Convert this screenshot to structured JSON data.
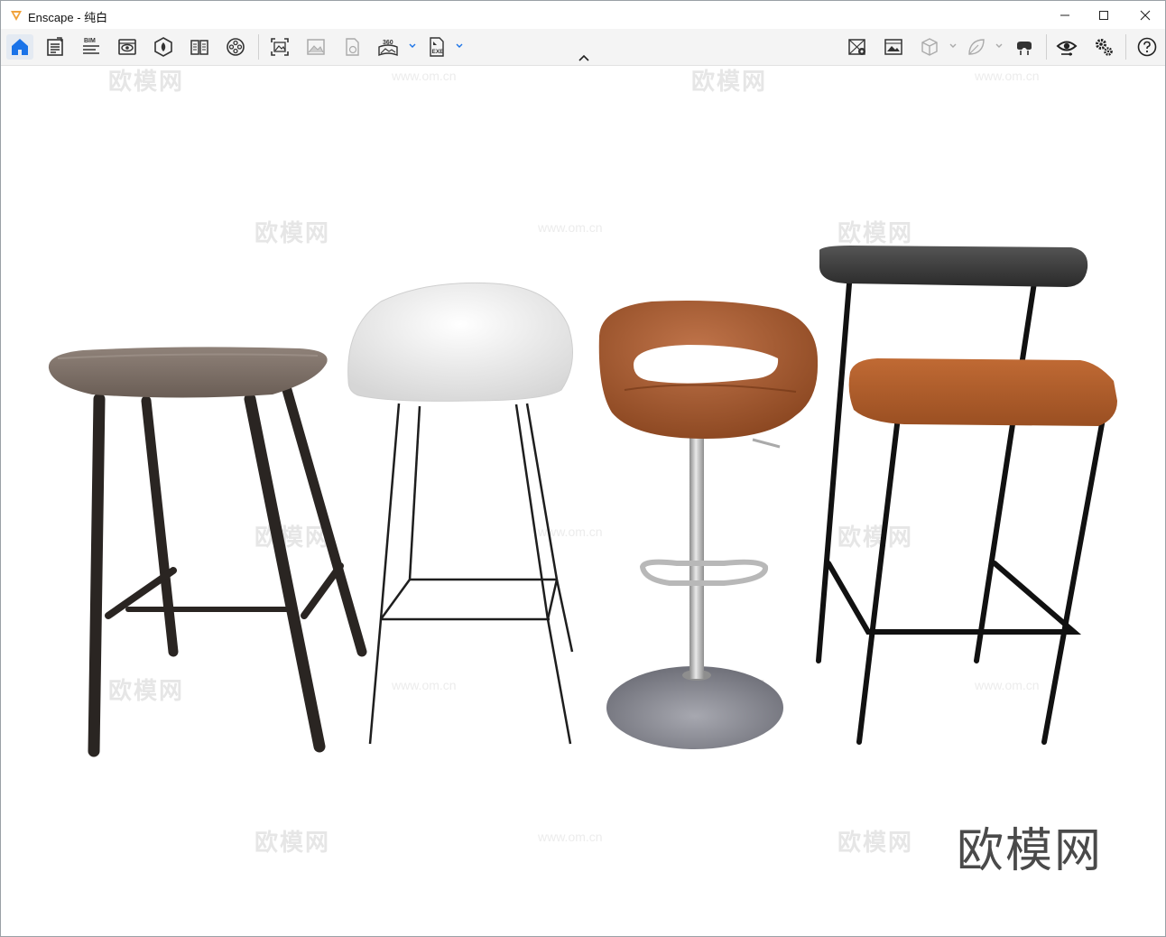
{
  "window": {
    "app_name": "Enscape",
    "separator": " - ",
    "scene_name": "纯白",
    "accent": "#f0a23a"
  },
  "toolbar": {
    "left_icons": [
      "home-icon",
      "file-icon",
      "bim-icon",
      "visual-settings-icon",
      "asset-library-icon",
      "book-icon",
      "video-reel-icon"
    ],
    "middle_icons": [
      "screenshot-icon",
      "batch-render-icon",
      "export-web-icon",
      "panorama-icon",
      "exe-export-icon"
    ],
    "right_icons": [
      "view-manager-icon",
      "capture-icon",
      "object-icon",
      "material-icon",
      "vr-headset-icon",
      "eye-icon",
      "settings-icon",
      "help-icon"
    ],
    "bim_label": "BIM",
    "pano_label": "360",
    "exe_label": "EXE",
    "accent_blue": "#1a73e8"
  },
  "watermark": {
    "brand": "欧模网",
    "url": "www.om.cn"
  }
}
